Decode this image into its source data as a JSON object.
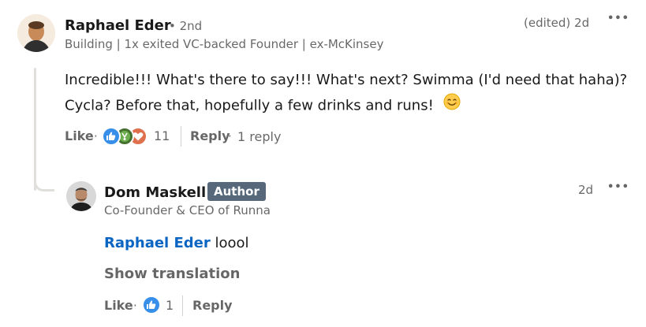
{
  "comment": {
    "author": "Raphael Eder",
    "degree": "• 2nd",
    "headline": "Building | 1x exited VC-backed Founder | ex-McKinsey",
    "meta": "(edited) 2d",
    "more_glyph": "•••",
    "text_line1": "Incredible!!! What's there to say!!! What's next? Swimma (I'd need that haha)?",
    "text_line2": "Cycla? Before that, hopefully a few drinks and runs!",
    "emoji": "smiling-face-emoji",
    "like_label": "Like",
    "reaction_count": "11",
    "reply_label": "Reply",
    "reply_count": "1 reply",
    "reactions": [
      "like-reaction-icon",
      "celebrate-reaction-icon",
      "love-reaction-icon"
    ]
  },
  "reply": {
    "author": "Dom Maskell",
    "badge": "Author",
    "headline": "Co-Founder & CEO of Runna",
    "meta": "2d",
    "more_glyph": "•••",
    "mention": "Raphael Eder",
    "text": "loool",
    "show_translation": "Show translation",
    "like_label": "Like",
    "reaction_count": "1",
    "reply_label": "Reply",
    "reactions": [
      "like-reaction-icon"
    ]
  },
  "colors": {
    "link": "#0a66c2",
    "badge": "#56687a",
    "like": "#378fe9",
    "celebrate": "#44712e",
    "love": "#df704d"
  },
  "separator_dot": "·"
}
